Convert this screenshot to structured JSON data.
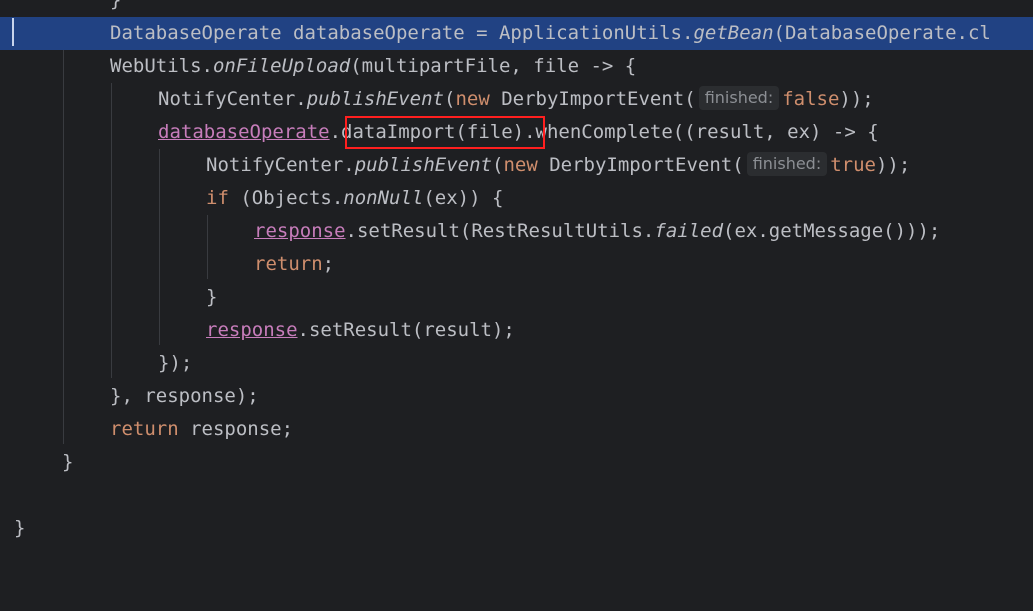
{
  "lines": {
    "l0": "}",
    "l1": {
      "type": "DatabaseOperate",
      "var": "databaseOperate",
      "eq": " = ",
      "cls": "ApplicationUtils.",
      "method": "getBean",
      "rest": "(DatabaseOperate.cl"
    },
    "l2": {
      "cls": "WebUtils.",
      "method": "onFileUpload",
      "rest": "(multipartFile, file -> {"
    },
    "l3": {
      "cls": "NotifyCenter.",
      "method": "publishEvent",
      "open": "(",
      "kw_new": "new",
      "ctor": " DerbyImportEvent(",
      "hint": "finished:",
      "value": "false",
      "close": "));"
    },
    "l4": {
      "field": "databaseOperate",
      "dot": ".",
      "call": "dataImport(file)",
      "rest": ".whenComplete((result, ex) -> {"
    },
    "l5": {
      "cls": "NotifyCenter.",
      "method": "publishEvent",
      "open": "(",
      "kw_new": "new",
      "ctor": " DerbyImportEvent(",
      "hint": "finished:",
      "value": "true",
      "close": "));"
    },
    "l6": {
      "kw_if": "if",
      "open": " (Objects.",
      "method": "nonNull",
      "rest": "(ex)) {"
    },
    "l7": {
      "field": "response",
      "mid": ".setResult(RestResultUtils.",
      "method": "failed",
      "rest": "(ex.getMessage()));"
    },
    "l8": {
      "kw_return": "return",
      "semi": ";"
    },
    "l9": "}",
    "l10": {
      "field": "response",
      "rest": ".setResult(result);"
    },
    "l11": "});",
    "l12": "}, response);",
    "l13": {
      "kw_return": "return",
      "rest": " response;"
    },
    "l14": "}",
    "l16": "}"
  },
  "colors": {
    "background": "#1e1f22",
    "highlight": "#214283",
    "keyword": "#cf8e6d",
    "field": "#c77dbb",
    "text": "#bcbec4",
    "annotation_box": "#ff1f1f"
  }
}
